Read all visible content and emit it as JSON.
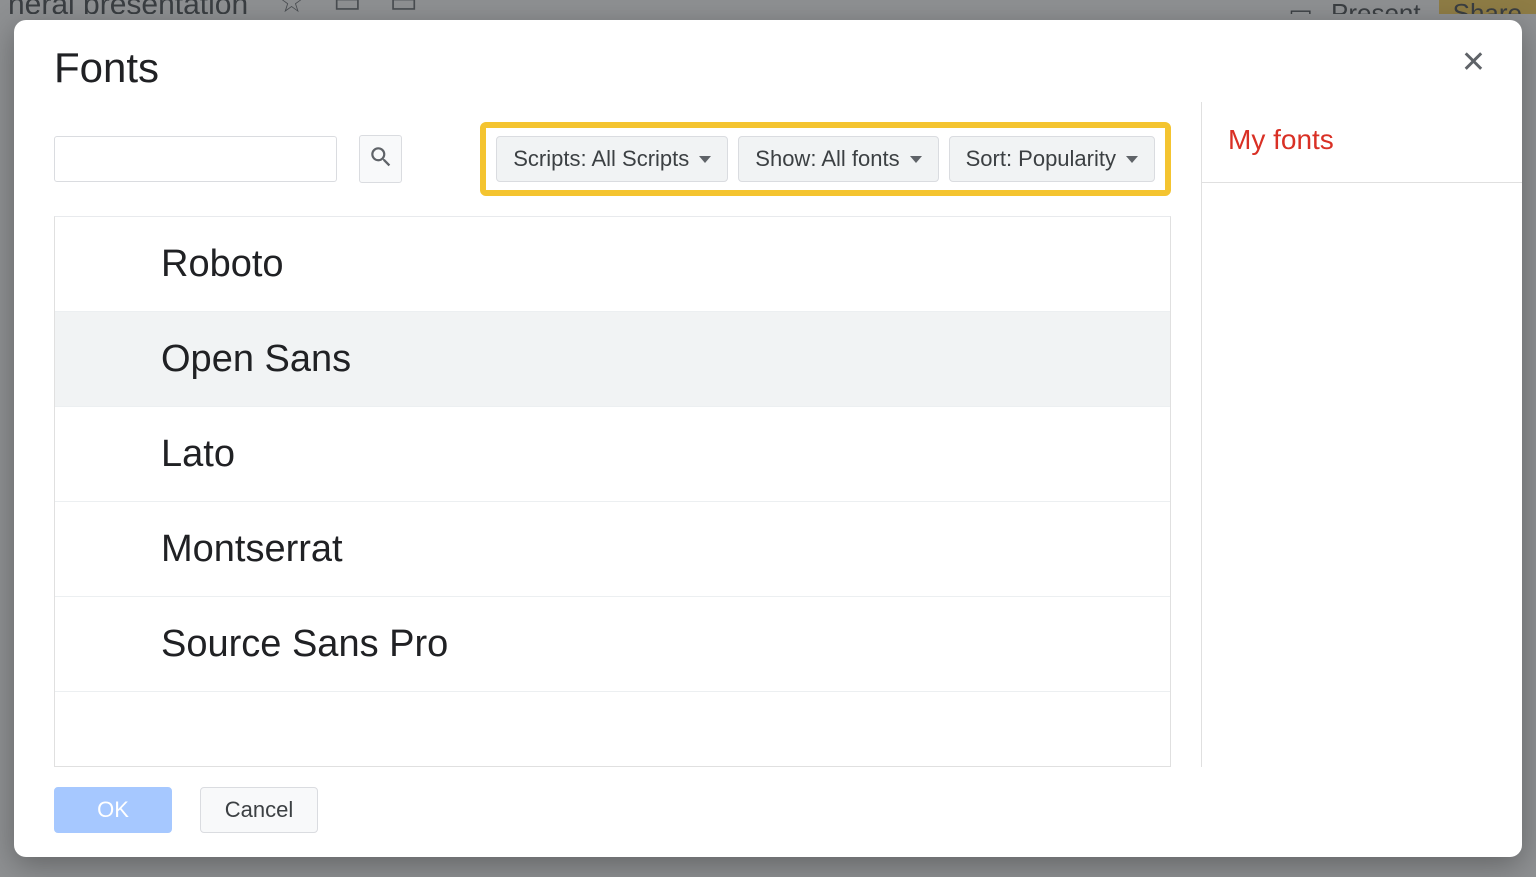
{
  "background": {
    "doc_title": "neral presentation",
    "present_label": "Present",
    "share_label": "Share"
  },
  "dialog": {
    "title": "Fonts",
    "search_value": "",
    "filters": {
      "scripts": "Scripts: All Scripts",
      "show": "Show: All fonts",
      "sort": "Sort: Popularity"
    },
    "fonts": [
      {
        "name": "Roboto",
        "hover": false
      },
      {
        "name": "Open Sans",
        "hover": true
      },
      {
        "name": "Lato",
        "hover": false
      },
      {
        "name": "Montserrat",
        "hover": false
      },
      {
        "name": "Source Sans Pro",
        "hover": false
      }
    ],
    "my_fonts_title": "My fonts",
    "ok_label": "OK",
    "cancel_label": "Cancel"
  }
}
